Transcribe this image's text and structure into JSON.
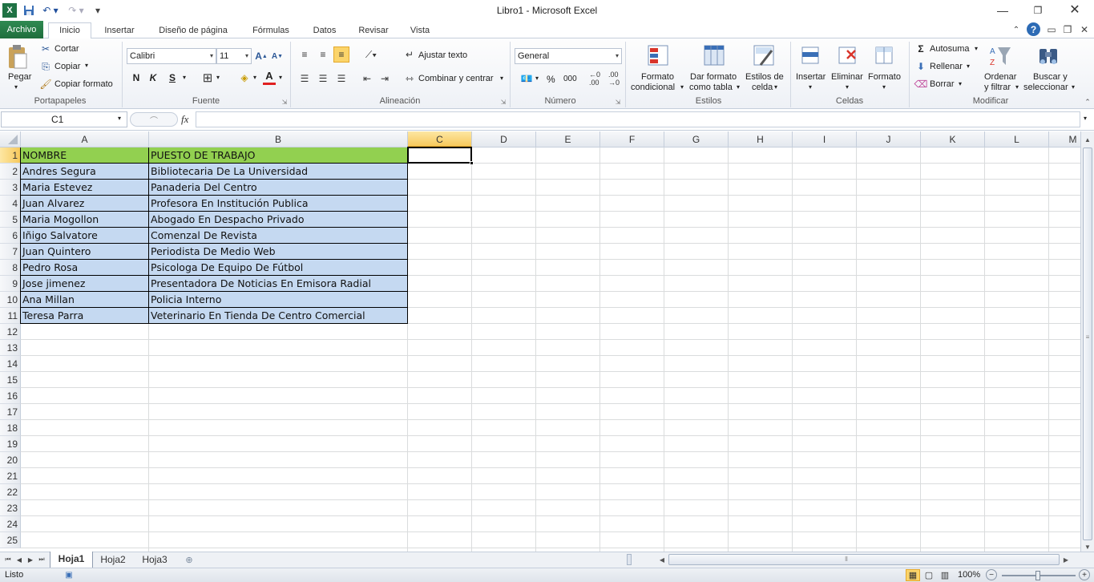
{
  "app": {
    "title": "Libro1  -  Microsoft Excel"
  },
  "tabs": [
    "Archivo",
    "Inicio",
    "Insertar",
    "Diseño de página",
    "Fórmulas",
    "Datos",
    "Revisar",
    "Vista"
  ],
  "ribbon": {
    "clipboard": {
      "paste": "Pegar",
      "cut": "Cortar",
      "copy": "Copiar",
      "format_painter": "Copiar formato",
      "label": "Portapapeles"
    },
    "font": {
      "name": "Calibri",
      "size": "11",
      "bold": "N",
      "italic": "K",
      "underline": "S",
      "label": "Fuente"
    },
    "alignment": {
      "wrap": "Ajustar texto",
      "merge": "Combinar y centrar",
      "label": "Alineación"
    },
    "number": {
      "format": "General",
      "percent": "%",
      "thousands": "000",
      "label": "Número"
    },
    "styles": {
      "conditional_1": "Formato",
      "conditional_2": "condicional",
      "table_1": "Dar formato",
      "table_2": "como tabla",
      "cell_1": "Estilos de",
      "cell_2": "celda",
      "label": "Estilos"
    },
    "cells": {
      "insert": "Insertar",
      "delete": "Eliminar",
      "format": "Formato",
      "label": "Celdas"
    },
    "editing": {
      "autosum": "Autosuma",
      "fill": "Rellenar",
      "clear": "Borrar",
      "sort_1": "Ordenar",
      "sort_2": "y filtrar",
      "find_1": "Buscar y",
      "find_2": "seleccionar",
      "label": "Modificar"
    }
  },
  "formula_bar": {
    "cell_ref": "C1",
    "fx": "fx",
    "value": ""
  },
  "columns": [
    "A",
    "B",
    "C",
    "D",
    "E",
    "F",
    "G",
    "H",
    "I",
    "J",
    "K",
    "L",
    "M"
  ],
  "rows": [
    "1",
    "2",
    "3",
    "4",
    "5",
    "6",
    "7",
    "8",
    "9",
    "10",
    "11",
    "12",
    "13",
    "14",
    "15",
    "16",
    "17",
    "18",
    "19",
    "20",
    "21",
    "22",
    "23",
    "24",
    "25"
  ],
  "table": {
    "header": [
      "NOMBRE",
      "PUESTO DE TRABAJO"
    ],
    "data": [
      [
        "Andres Segura",
        "Bibliotecaria De La Universidad"
      ],
      [
        "Maria Estevez",
        "Panaderia Del Centro"
      ],
      [
        "Juan Alvarez",
        "Profesora En Institución Publica"
      ],
      [
        "Maria Mogollon",
        "Abogado En Despacho Privado"
      ],
      [
        "Iñigo Salvatore",
        "Comenzal De Revista"
      ],
      [
        "Juan Quintero",
        "Periodista De Medio Web"
      ],
      [
        "Pedro Rosa",
        "Psicologa De Equipo De Fútbol"
      ],
      [
        "Jose jimenez",
        "Presentadora De Noticias En Emisora Radial"
      ],
      [
        "Ana Millan",
        "Policia Interno"
      ],
      [
        "Teresa Parra",
        "Veterinario En Tienda De Centro Comercial"
      ]
    ],
    "header_color": "#92d050",
    "data_color": "#c5d9f1"
  },
  "sheets": [
    "Hoja1",
    "Hoja2",
    "Hoja3"
  ],
  "status": {
    "ready": "Listo",
    "zoom": "100%"
  }
}
